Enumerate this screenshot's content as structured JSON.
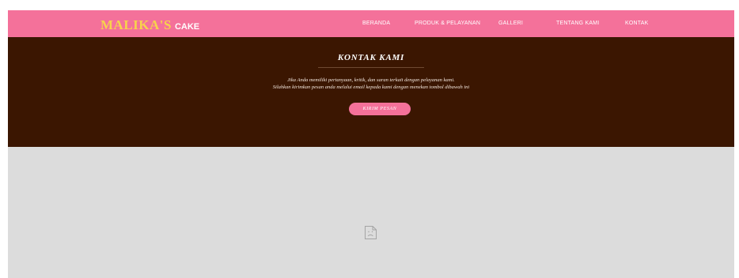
{
  "navbar": {
    "brand_main": "MALIKA'S",
    "brand_sub": "CAKE",
    "links": [
      "BERANDA",
      "PRODUK & PELAYANAN",
      "GALLERI",
      "TENTANG KAMI",
      "KONTAK"
    ]
  },
  "hero": {
    "title": "KONTAK KAMI",
    "line1": "Jika Anda memiliki pertanyaan, kritik, dan saran terkait dengan pelayanan kami.",
    "line2": "Silahkan kirimkan pesan anda melalui email kepada kami dengan menekan tombol dibawah ini",
    "button_label": "KIRIM PESAN"
  },
  "map": {
    "icon": "broken-image-icon"
  },
  "colors": {
    "navbar_bg": "#f4719a",
    "brand_yellow": "#f7d24c",
    "hero_bg": "#3b1601",
    "map_bg": "#dcdcdc"
  }
}
